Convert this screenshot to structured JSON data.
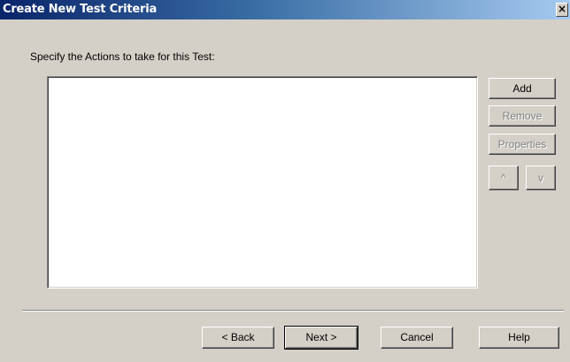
{
  "window": {
    "title": "Create New Test Criteria",
    "close_glyph": "×"
  },
  "instruction": "Specify the Actions to take for this Test:",
  "actions_list": {
    "items": []
  },
  "side_buttons": {
    "add": "Add",
    "remove": "Remove",
    "properties": "Properties",
    "move_up": "^",
    "move_down": "v"
  },
  "footer": {
    "back": "< Back",
    "next": "Next >",
    "cancel": "Cancel",
    "help": "Help"
  },
  "colors": {
    "title_bar_start": "#0a246a",
    "title_bar_end": "#a6caf0",
    "face": "#d4d0c8",
    "disabled_text": "#808080"
  }
}
